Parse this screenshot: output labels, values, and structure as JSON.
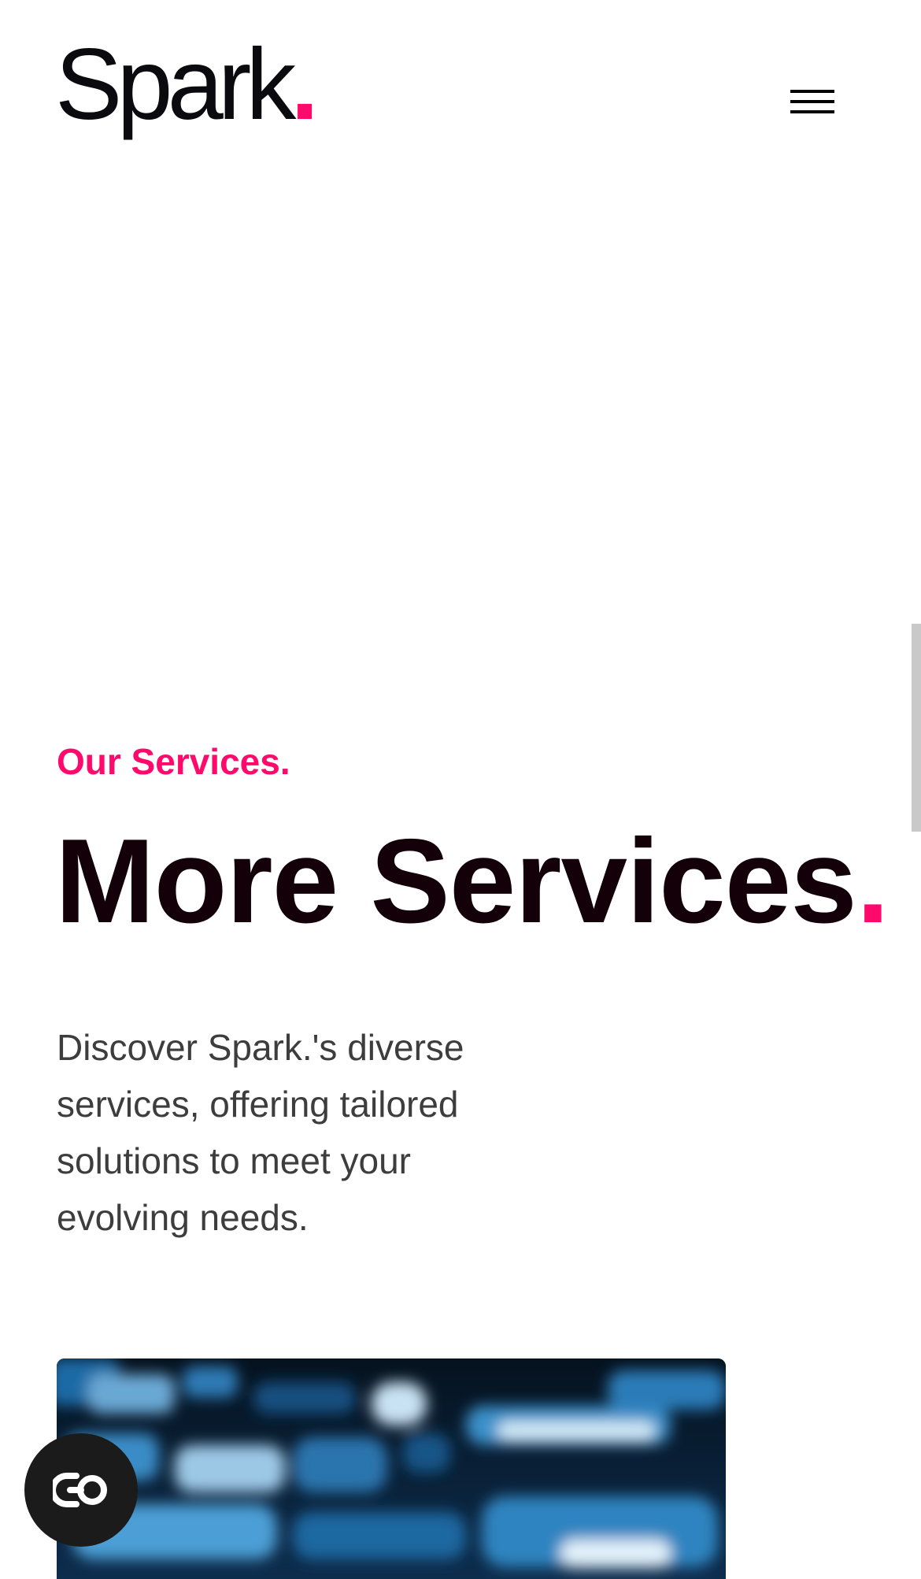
{
  "header": {
    "logo_text": "Spark",
    "logo_dot": ".",
    "menu_icon": "hamburger-icon"
  },
  "services": {
    "eyebrow": "Our Services.",
    "title": "More Services",
    "title_dot": ".",
    "description": "Discover Spark.'s diverse services, offering tailored solutions to meet your evolving needs."
  },
  "floating": {
    "chat_icon": "chat-widget-icon"
  },
  "colors": {
    "accent": "#ff0a6c",
    "text_dark": "#130008",
    "body_text": "#3d3d3d",
    "image_base": "#0a1e33"
  }
}
